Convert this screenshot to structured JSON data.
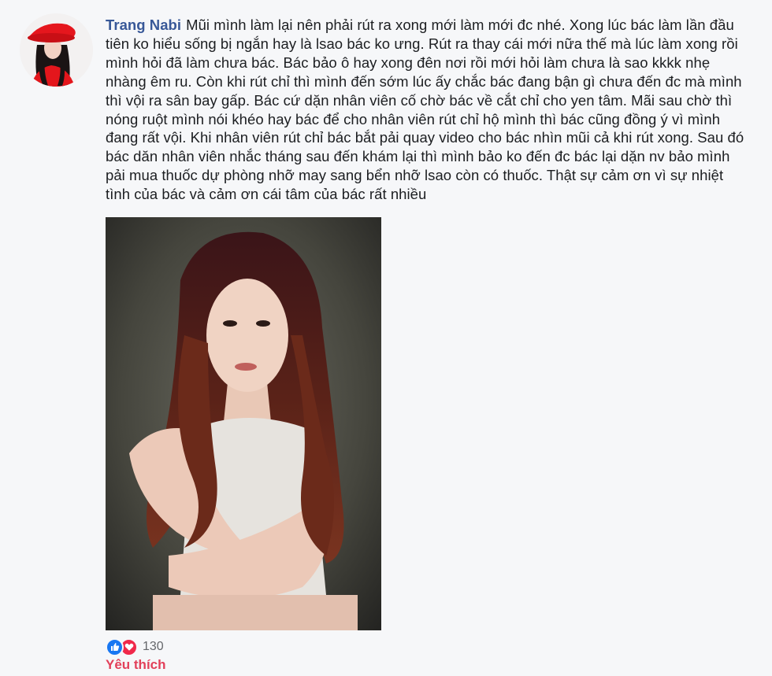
{
  "comment": {
    "author": "Trang Nabi",
    "text": "Mũi mình làm lại nên phải rút ra xong mới làm mới đc nhé. Xong lúc bác làm lần đầu tiên ko hiểu sống bị ngắn hay là lsao bác ko ưng. Rút ra thay cái mới nữa thế mà lúc làm xong rồi mình hỏi đã làm chưa bác. Bác bảo ô hay xong đên nơi rồi mới hỏi làm chưa là sao kkkk nhẹ nhàng êm ru. Còn khi rút chỉ thì mình đến sớm lúc ấy chắc bác đang bận gì chưa đến đc mà mình thì vội ra sân bay gấp. Bác cứ dặn nhân viên cố chờ bác về cắt chỉ cho yen tâm. Mãi sau chờ thì nóng ruột mình nói khéo hay bác để cho nhân viên rút chỉ hộ mình thì bác cũng đồng ý vì mình đang rất vội. Khi nhân viên rút chỉ bác bắt pải quay video cho bác nhìn mũi cả khi rút xong. Sau đó bác dăn nhân viên nhắc tháng sau đến khám lại thì mình bảo ko đến đc bác lại dặn nv bảo mình pải mua thuốc dự phòng nhỡ may sang bển nhỡ lsao còn có thuốc. Thật sự cảm ơn vì sự nhiệt tình của bác và cảm ơn cái tâm của bác rất nhiều"
  },
  "reactions": {
    "icons": [
      "like-icon",
      "love-icon"
    ],
    "count": "130"
  },
  "actions": {
    "like_label": "Yêu thích"
  },
  "colors": {
    "author": "#385898",
    "like_active": "#e2405a",
    "like_reaction": "#1877f2",
    "love_reaction": "#f0284a"
  }
}
